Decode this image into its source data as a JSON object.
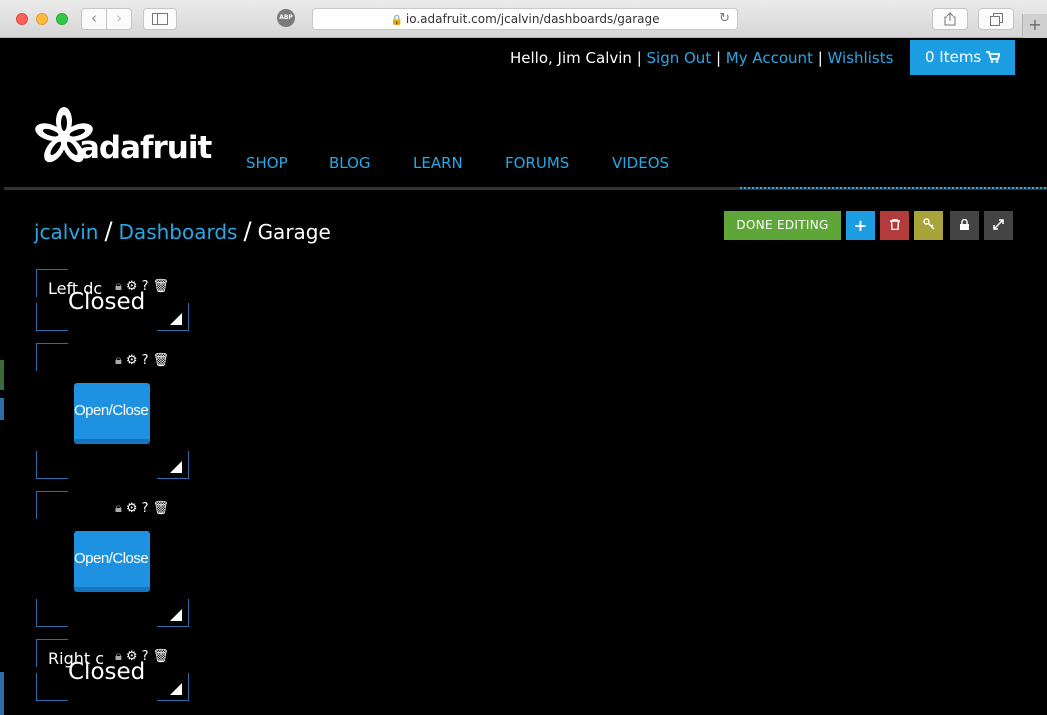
{
  "browser": {
    "url": "io.adafruit.com/jcalvin/dashboards/garage",
    "abp_label": "ABP",
    "back_icon": "chevron-left-icon",
    "forward_icon": "chevron-right-icon"
  },
  "header": {
    "greeting": "Hello, Jim Calvin",
    "sign_out": "Sign Out",
    "my_account": "My Account",
    "wishlists": "Wishlists",
    "cart_label": "0 Items",
    "logo_text": "adafruit"
  },
  "nav": [
    "SHOP",
    "BLOG",
    "LEARN",
    "FORUMS",
    "VIDEOS"
  ],
  "breadcrumb": {
    "user": "jcalvin",
    "section": "Dashboards",
    "current": "Garage"
  },
  "actions": {
    "done_editing": "DONE EDITING"
  },
  "widgets": [
    {
      "title": "Left dc",
      "value": "Closed"
    },
    {
      "button": "Open/Close"
    },
    {
      "button": "Open/Close"
    },
    {
      "title": "Right c",
      "value": "Closed"
    }
  ],
  "colors": {
    "accent": "#2aa7e5",
    "cart": "#1d9ee2",
    "done": "#5fa638",
    "danger": "#b43b3b",
    "key": "#a8a43a",
    "button": "#1e92e0"
  }
}
